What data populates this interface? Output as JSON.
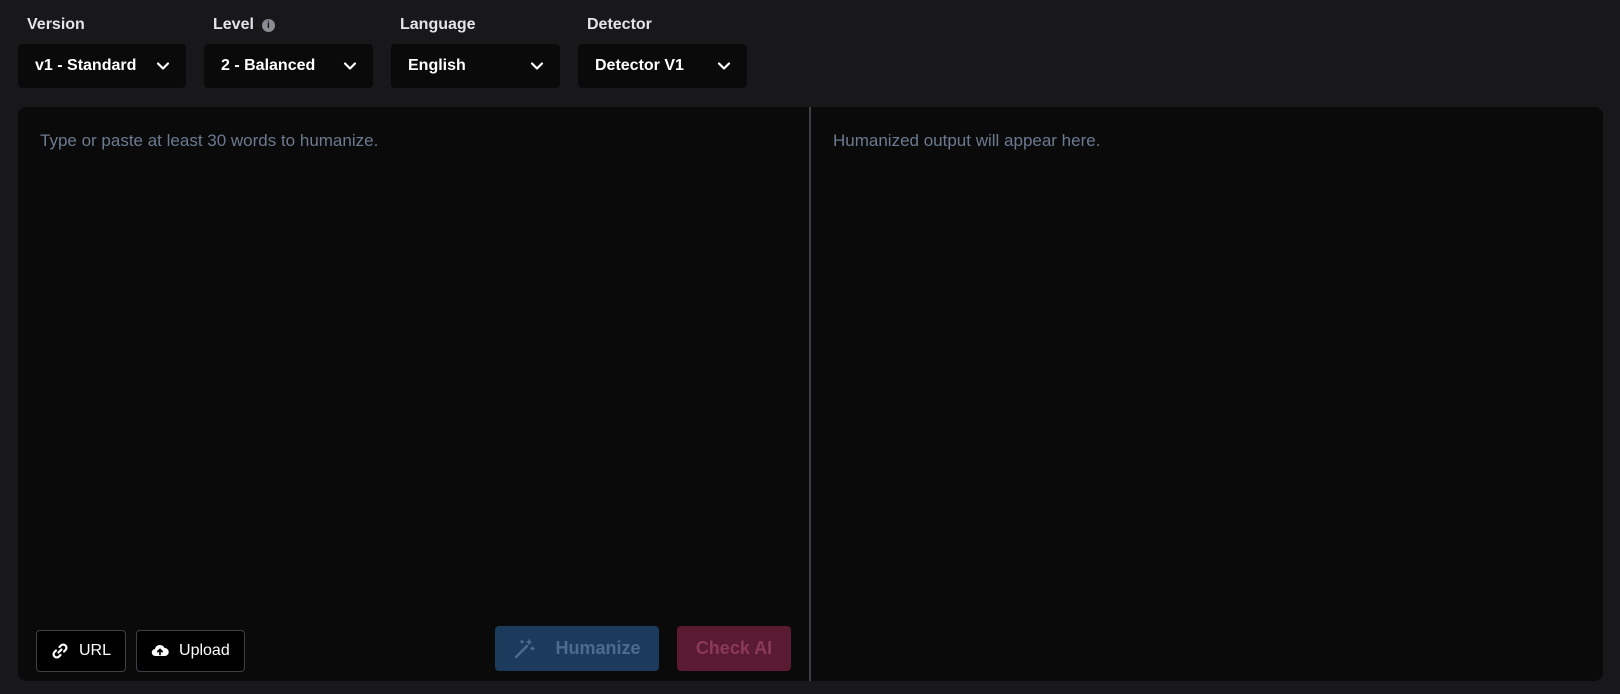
{
  "toolbar": {
    "version": {
      "label": "Version",
      "value": "v1 - Standard"
    },
    "level": {
      "label": "Level",
      "value": "2 - Balanced",
      "info_icon": "info-icon"
    },
    "language": {
      "label": "Language",
      "value": "English"
    },
    "detector": {
      "label": "Detector",
      "value": "Detector V1"
    }
  },
  "input": {
    "placeholder": "Type or paste at least 30 words to humanize.",
    "value": ""
  },
  "output": {
    "placeholder": "Humanized output will appear here."
  },
  "buttons": {
    "url_label": "URL",
    "upload_label": "Upload",
    "humanize_label": "Humanize",
    "check_ai_label": "Check AI"
  },
  "icons": {
    "url": "link-icon",
    "upload": "cloud-upload-icon",
    "humanize": "magic-wand-icon",
    "dropdown": "chevron-down-icon"
  },
  "colors": {
    "background": "#18181b",
    "panel": "#0a0a0a",
    "humanize_button": "#1c3a5c",
    "check_ai_button": "#5a1a32",
    "placeholder_text": "#6b7a90"
  }
}
